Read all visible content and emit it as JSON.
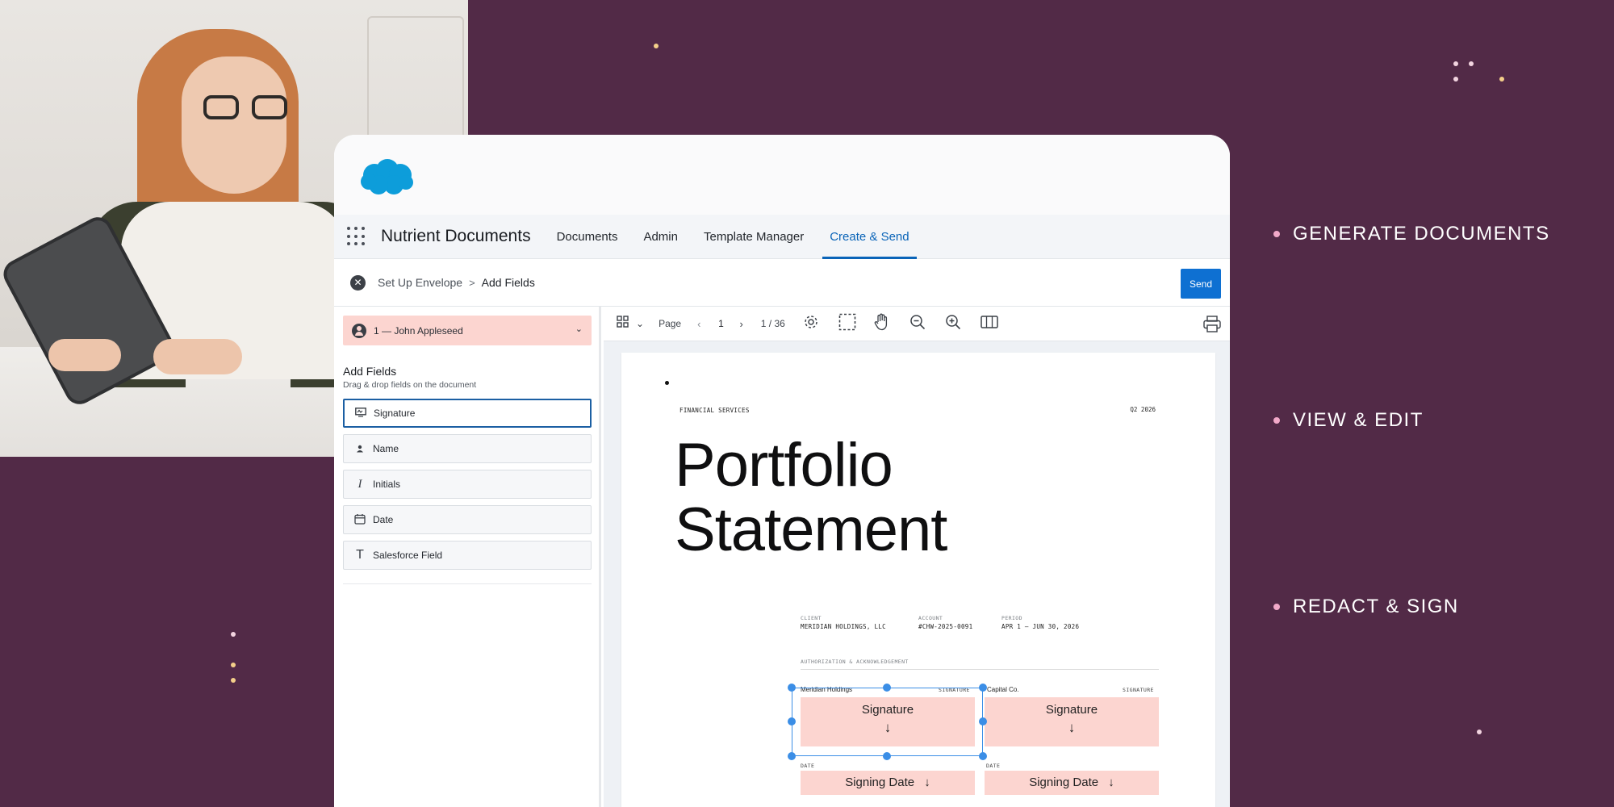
{
  "colors": {
    "background": "#522a47",
    "accent_blue": "#0e70d2",
    "field_pink": "#fcd5d0",
    "selection_blue": "#3b8ee6",
    "feature_bullet": "#f2a9c9",
    "dot_cream": "#f4cf8a",
    "dot_pink": "#f2d4e0"
  },
  "brand": {
    "logo_icon": "salesforce-cloud-icon"
  },
  "nav": {
    "app_name": "Nutrient Documents",
    "items": [
      {
        "label": "Documents",
        "active": false
      },
      {
        "label": "Admin",
        "active": false
      },
      {
        "label": "Template Manager",
        "active": false
      },
      {
        "label": "Create & Send",
        "active": true
      }
    ]
  },
  "breadcrumb": {
    "step_1": "Set Up Envelope",
    "separator": ">",
    "step_2": "Add Fields",
    "send_label": "Send"
  },
  "recipient": {
    "label": "1 — John Appleseed"
  },
  "add_fields": {
    "title": "Add Fields",
    "subtitle": "Drag & drop fields on the document",
    "fields": [
      {
        "label": "Signature",
        "icon": "signature-icon",
        "selected": true
      },
      {
        "label": "Name",
        "icon": "person-icon",
        "selected": false
      },
      {
        "label": "Initials",
        "icon": "italic-i-icon",
        "selected": false
      },
      {
        "label": "Date",
        "icon": "calendar-icon",
        "selected": false
      },
      {
        "label": "Salesforce Field",
        "icon": "text-t-icon",
        "selected": false
      }
    ]
  },
  "viewer": {
    "page_label": "Page",
    "page_number": "1",
    "page_count": "1 / 36"
  },
  "document": {
    "kicker": "FINANCIAL SERVICES",
    "quarter": "Q2 2026",
    "title_line_1": "Portfolio",
    "title_line_2": "Statement",
    "meta": [
      {
        "label": "CLIENT",
        "value": "MERIDIAN HOLDINGS, LLC"
      },
      {
        "label": "ACCOUNT",
        "value": "#CHW-2025-0091"
      },
      {
        "label": "PERIOD",
        "value": "APR 1 — JUN 30, 2026"
      }
    ],
    "auth_heading": "AUTHORIZATION & ACKNOWLEDGEMENT",
    "parties": [
      {
        "name": "Meridian Holdings",
        "sig_caption": "SIGNATURE",
        "sig_label": "Signature",
        "date_caption": "DATE",
        "date_label": "Signing Date"
      },
      {
        "name": "Capital Co.",
        "sig_caption": "SIGNATURE",
        "sig_label": "Signature",
        "date_caption": "DATE",
        "date_label": "Signing Date"
      }
    ],
    "down_arrow": "↓"
  },
  "features": [
    {
      "label": "GENERATE DOCUMENTS"
    },
    {
      "label": "VIEW & EDIT"
    },
    {
      "label": "REDACT & SIGN"
    }
  ]
}
